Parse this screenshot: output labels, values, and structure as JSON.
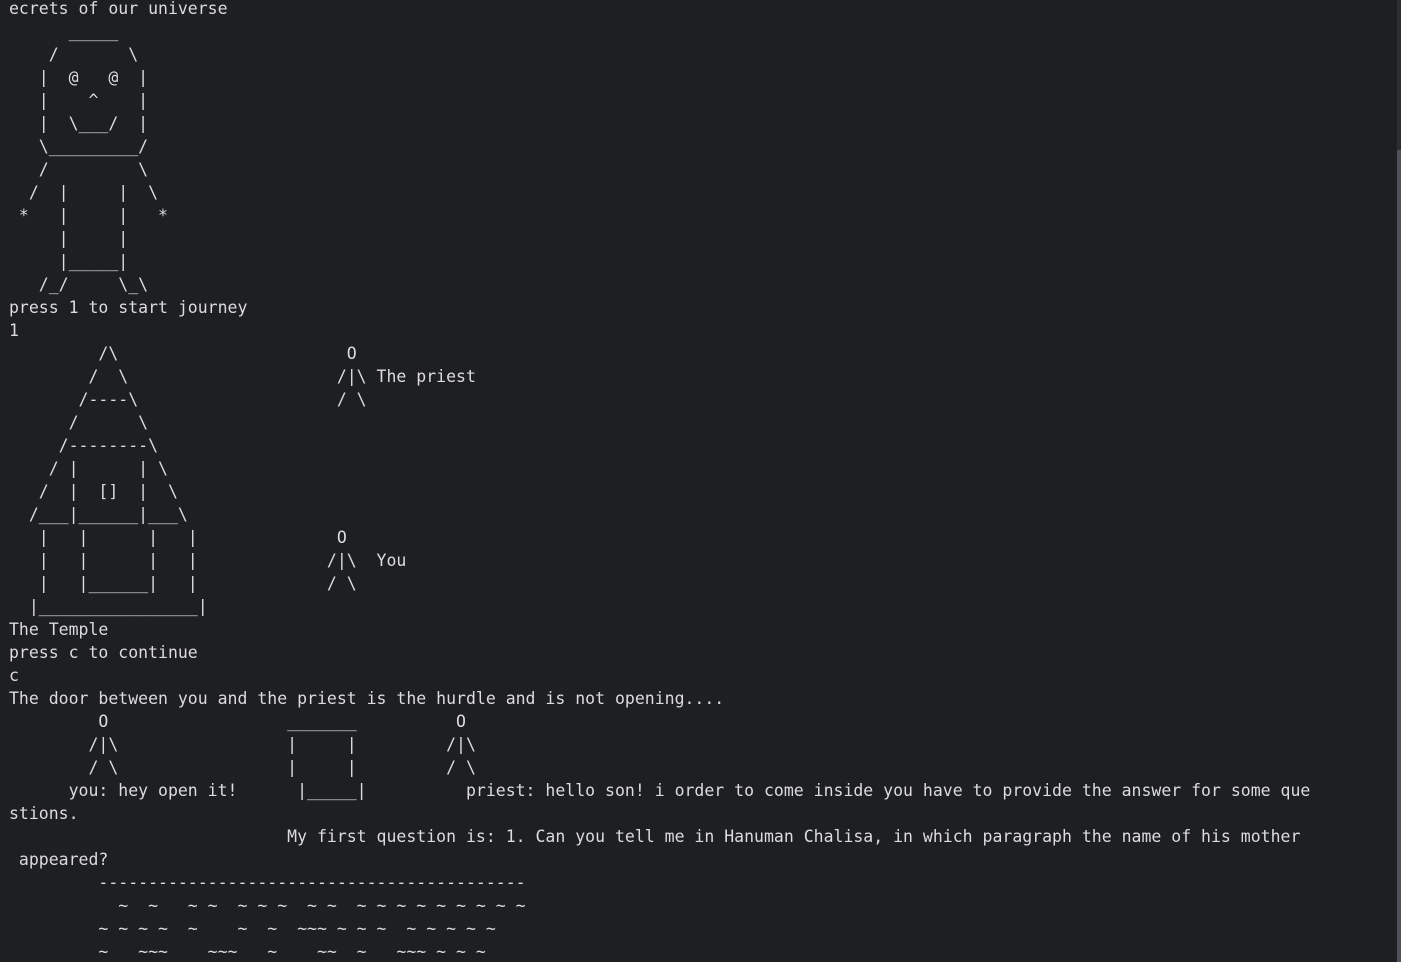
{
  "terminal": {
    "lines": [
      "ecrets of our universe",
      "      _____",
      "    /       \\",
      "   |  @   @  |",
      "   |    ^    |",
      "   |  \\___/  |",
      "   \\_________/",
      "   /         \\",
      "  /  |     |  \\",
      " *   |     |   *",
      "     |     |",
      "     |_____|",
      "   /_/     \\_\\",
      "press 1 to start journey",
      "1",
      "         /\\                       O",
      "        /  \\                     /|\\ The priest",
      "       /----\\                    / \\",
      "      /      \\",
      "     /--------\\",
      "    / |      | \\",
      "   /  |  []  |  \\",
      "  /___|______|___\\",
      "   |   |      |   |              O",
      "   |   |      |   |             /|\\  You",
      "   |   |______|   |             / \\",
      "  |________________|",
      "The Temple",
      "press c to continue",
      "c",
      "The door between you and the priest is the hurdle and is not opening....",
      "         O                  _______          O",
      "        /|\\                 |     |         /|\\",
      "        / \\                 |     |         / \\",
      "      you: hey open it!      |_____|          priest: hello son! i order to come inside you have to provide the answer for some que",
      "stions.",
      "                            My first question is: 1. Can you tell me in Hanuman Chalisa, in which paragraph the name of his mother",
      " appeared?",
      "         -------------------------------------------",
      "           ~  ~   ~ ~  ~ ~ ~  ~ ~  ~ ~ ~ ~ ~ ~ ~ ~ ~",
      "         ~ ~ ~ ~  ~    ~  ~  ~~~ ~ ~ ~  ~ ~ ~ ~ ~",
      "         ~   ~~~    ~~~   ~    ~~  ~   ~~~ ~ ~ ~"
    ]
  },
  "colors": {
    "background": "#1e1f22",
    "text": "#dcdcdc",
    "scrollbar_thumb": "#4e5157"
  }
}
